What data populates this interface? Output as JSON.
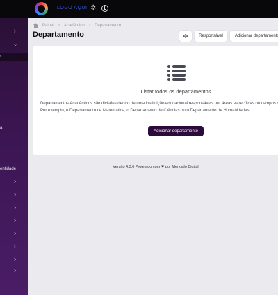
{
  "topbar": {
    "logo_text": "LOGO AQUI",
    "icons": [
      "gear-icon",
      "clock-icon"
    ]
  },
  "sidebar": {
    "partial_labels": [
      "a",
      "entidade"
    ],
    "chevron_count": 11
  },
  "breadcrumb": {
    "items": [
      "Painel",
      "Acadêmico",
      "Departamento"
    ]
  },
  "page": {
    "title": "Departamento"
  },
  "toolbar": {
    "move_icon": "✣",
    "responsavel_label": "Responsável",
    "add_label": "Adicionar departamento"
  },
  "empty_state": {
    "icon": "list-icon",
    "heading": "Listar todos os departamentos",
    "description": "Departamentos Acadêmicos são divisões dentro de uma instituição educacional responsáveis por áreas específicas ou campos de estudo. Por exemplo, o Departamento de Matemática, o Departamento de Ciências ou o Departamento de Humanidades.",
    "button_label": "Adicionar departamento"
  },
  "footer": {
    "prefix": "Versão 4.3.0  Projetado com",
    "suffix": "por Merkado Digital",
    "heart": "❤"
  },
  "colors": {
    "sidebar": "#3b1552",
    "primary_button": "#2d0a3c",
    "topbar": "#08070a",
    "logo_text": "#3b5bd9"
  }
}
